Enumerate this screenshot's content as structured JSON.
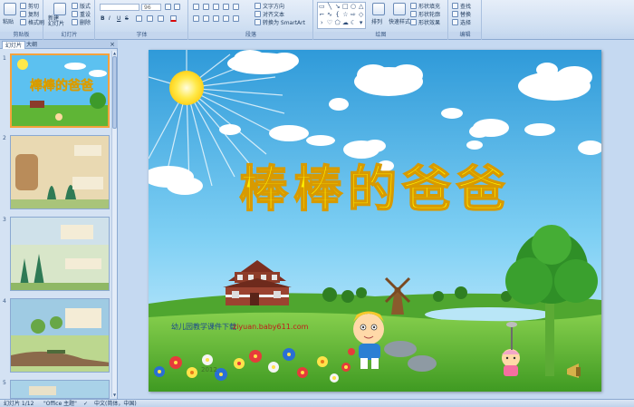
{
  "ribbon": {
    "clipboard": {
      "label": "剪贴板",
      "paste": "粘贴",
      "cut": "剪切",
      "copy": "复制",
      "format_painter": "格式刷"
    },
    "slides": {
      "label": "幻灯片",
      "new_slide": "新建\n幻灯片",
      "layout": "版式",
      "reset": "重设",
      "delete": "删除"
    },
    "font": {
      "label": "字体",
      "font_name": "",
      "font_size": "96",
      "bold": "B",
      "italic": "I",
      "underline": "U",
      "strike": "S"
    },
    "paragraph": {
      "label": "段落",
      "text_direction": "文字方向",
      "align_text": "对齐文本",
      "smartart": "转换为 SmartArt"
    },
    "drawing": {
      "label": "绘图",
      "arrange": "排列",
      "quick_styles": "快速样式",
      "shape_fill": "形状填充",
      "shape_outline": "形状轮廓",
      "shape_effects": "形状效果"
    },
    "editing": {
      "label": "编辑",
      "find": "查找",
      "replace": "替换",
      "select": "选择"
    }
  },
  "side_panel": {
    "tabs": [
      "幻灯片",
      "大纲"
    ],
    "close": "×",
    "thumbnails": [
      {
        "number": "1",
        "selected": true
      },
      {
        "number": "2",
        "selected": false
      },
      {
        "number": "3",
        "selected": false
      },
      {
        "number": "4",
        "selected": false
      },
      {
        "number": "5",
        "selected": false
      }
    ]
  },
  "slide": {
    "title": "棒棒的爸爸",
    "footer_credit": "幼儿园教学课件下载",
    "footer_url": "ziyuan.baby611.com",
    "page_marker": "2012"
  },
  "status_bar": {
    "slide_position": "幻灯片 1/12",
    "theme": "\"Office 主题\"",
    "language": "中文(简体，中国)"
  },
  "colors": {
    "ribbon_bg": "#dbe7f6",
    "sky_top": "#2f9ad9",
    "grass": "#62b534",
    "title": "#fff200",
    "selection": "#f4a23c"
  }
}
